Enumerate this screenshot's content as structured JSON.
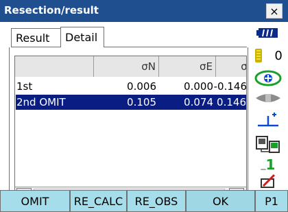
{
  "window": {
    "title": "Resection/result",
    "close_label": "×"
  },
  "tabs": [
    {
      "label": "Result"
    },
    {
      "label": "Detail"
    }
  ],
  "table": {
    "columns": [
      "",
      "σN",
      "σE",
      "σZ"
    ],
    "rows": [
      {
        "name": "1st",
        "sn": "0.006",
        "se": "0.000",
        "sz": "-0.146",
        "selected": false
      },
      {
        "name": "2nd OMIT",
        "sn": "0.105",
        "se": "0.074",
        "sz": "0.146",
        "selected": true
      }
    ],
    "scroll_left": "◀",
    "scroll_right": "▶"
  },
  "status": {
    "count": "0",
    "indicator_value": "1",
    "icons": [
      "battery-icon",
      "memory-card-icon",
      "target-prism-icon",
      "laser-icon",
      "tilt-icon",
      "communication-icon",
      "input-mode-icon",
      "pen-icon"
    ]
  },
  "softkeys": [
    "OMIT",
    "RE_CALC",
    "RE_OBS",
    "OK",
    "P1"
  ],
  "colors": {
    "titlebar": "#1f4f8f",
    "selection": "#0a1d82",
    "softkey": "#a6ddea",
    "accent_green": "#1aa02a"
  }
}
